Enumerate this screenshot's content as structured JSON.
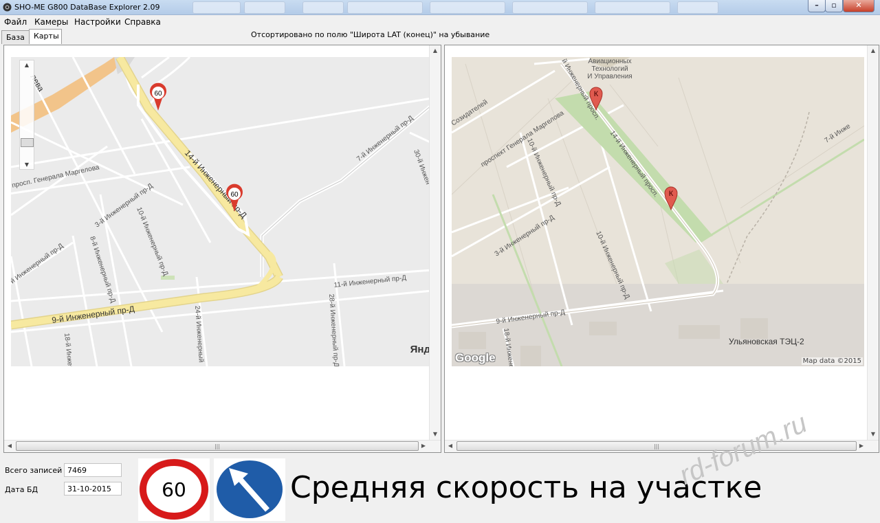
{
  "window": {
    "title": "SHO-ME G800 DataBase Explorer 2.09",
    "minimize_icon": "minimize-icon",
    "maximize_icon": "maximize-icon",
    "close_icon": "close-icon"
  },
  "menu": {
    "file": "Файл",
    "cameras": "Камеры",
    "settings": "Настройки",
    "help": "Справка"
  },
  "tabs": {
    "base": "База",
    "maps": "Карты"
  },
  "sort_status": "Отсортировано по полю \"Широта LAT (конец)\" на убывание",
  "left_map": {
    "provider_logo": "Янд",
    "markers": [
      "60",
      "60"
    ],
    "streets": {
      "s14": "14-й Инженерный пр-Д",
      "s7": "7-й Инженерный пр-Д",
      "s30": "30-й Инжен",
      "s9": "9-й Инженерный пр-Д",
      "s11": "11-й Инженерный пр-Д",
      "s3": "3-й Инженерный пр-Д",
      "s10": "10-й Инженерный пр-Д",
      "s8": "8-й Инженерный пр-Д",
      "s28": "28-й Инженерный пр-Д",
      "s24": "24-й Инженерный",
      "s18": "18-й Инженерный",
      "margelova": "просп. Генерала Маргелова",
      "prosp_nd": "й Инженерный пр-Д",
      "top": "лева"
    }
  },
  "right_map": {
    "provider_logo": "Google",
    "map_data": "Map data ©2015",
    "markers": [
      "К",
      "К"
    ],
    "poi": [
      "Авиационных",
      "Технологий",
      "И Управления"
    ],
    "tec": "Ульяновская ТЭЦ-2",
    "streets": {
      "s14": "14-й Инженерный просп.",
      "s14top": "й Инженерный просп.",
      "sozid": "Созидателей",
      "margelova": "проспект Генерала Маргелова",
      "s10a": "10-й Инженерный пр-Д",
      "s10b": "10-й Инженерный пр-Д",
      "s3": "3-й Инженерный пр-Д",
      "s9": "9-й Инженерный пр-Д",
      "s7": "7-й Инже",
      "s18": "18-й Инжене"
    }
  },
  "info": {
    "total_label": "Всего записей",
    "total_value": "7469",
    "date_label": "Дата БД",
    "date_value": "31-10-2015"
  },
  "signs": {
    "speed_limit": "60",
    "speed_icon": "speed-limit-sign-icon",
    "direction_icon": "keep-left-sign-icon"
  },
  "camera_type": "Средняя скорость на участке",
  "watermark": "rd-forum.ru",
  "colors": {
    "titlebar": "#b9cfea",
    "yandex_road": "#f7e9a0",
    "google_green": "#c3dcad",
    "marker_red": "#d93b2d"
  }
}
